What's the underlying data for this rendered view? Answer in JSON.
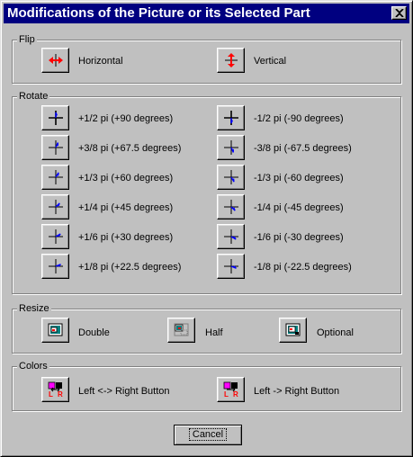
{
  "window": {
    "title": "Modifications of the Picture or its Selected Part"
  },
  "flip": {
    "label": "Flip",
    "horizontal": "Horizontal",
    "vertical": "Vertical"
  },
  "rotate": {
    "label": "Rotate",
    "left": [
      "+1/2 pi (+90 degrees)",
      "+3/8 pi (+67.5 degrees)",
      "+1/3 pi (+60 degrees)",
      "+1/4 pi (+45 degrees)",
      "+1/6 pi (+30 degrees)",
      "+1/8 pi (+22.5 degrees)"
    ],
    "right": [
      "-1/2 pi (-90 degrees)",
      "-3/8 pi (-67.5 degrees)",
      "-1/3 pi (-60 degrees)",
      "-1/4 pi (-45 degrees)",
      "-1/6 pi (-30 degrees)",
      "-1/8 pi (-22.5 degrees)"
    ]
  },
  "resize": {
    "label": "Resize",
    "double": "Double",
    "half": "Half",
    "optional": "Optional"
  },
  "colors": {
    "label": "Colors",
    "swap": "Left <-> Right Button",
    "copy": "Left -> Right Button",
    "icon_letters": {
      "left": "L",
      "right": "R"
    }
  },
  "cancel_label": "Cancel",
  "theme": {
    "titlebar": "#000080",
    "face": "#c0c0c0",
    "arrow_red": "#ff0000",
    "arrow_blue": "#0000ff"
  },
  "icons": {
    "close": "close-icon",
    "flip_h": "flip-horizontal-icon",
    "flip_v": "flip-vertical-icon",
    "rotate": "rotate-icon",
    "double": "resize-double-icon",
    "half": "resize-half-icon",
    "optional": "resize-optional-icon",
    "colors": "color-swap-icon"
  }
}
